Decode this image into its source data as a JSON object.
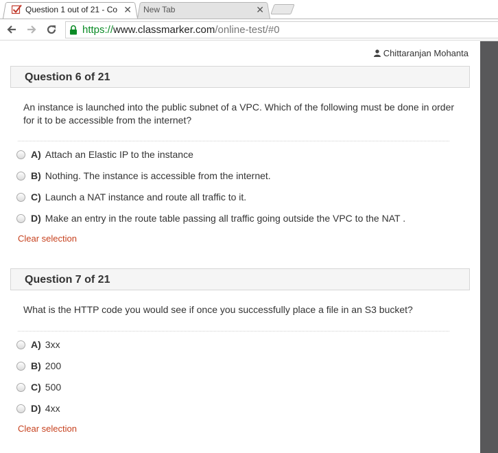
{
  "browser": {
    "tabs": [
      {
        "title": "Question 1 out of 21 - Co",
        "active": true
      },
      {
        "title": "New Tab",
        "active": false
      }
    ],
    "url": {
      "scheme": "https://",
      "host": "www.classmarker.com",
      "path": "/online-test/#0"
    },
    "accent": "#0a8a25"
  },
  "user": {
    "name": "Chittaranjan Mohanta"
  },
  "questions": [
    {
      "header": "Question 6 of 21",
      "text": "An instance is launched into the public subnet of a VPC. Which of the following must be done in order for it to be accessible from the internet?",
      "options": [
        {
          "letter": "A)",
          "text": "Attach an Elastic IP to the instance"
        },
        {
          "letter": "B)",
          "text": "Nothing. The instance is accessible from the internet."
        },
        {
          "letter": "C)",
          "text": "Launch a NAT instance and route all traffic to it."
        },
        {
          "letter": "D)",
          "text": "Make an entry in the route table passing all traffic going outside the VPC to the NAT ."
        }
      ],
      "clear_label": "Clear selection"
    },
    {
      "header": "Question 7 of 21",
      "text": "What is the HTTP code you would see if once you successfully place a file in an S3 bucket?",
      "options": [
        {
          "letter": "A)",
          "text": "3xx"
        },
        {
          "letter": "B)",
          "text": "200"
        },
        {
          "letter": "C)",
          "text": "500"
        },
        {
          "letter": "D)",
          "text": "4xx"
        }
      ],
      "clear_label": "Clear selection"
    }
  ],
  "colors": {
    "clear_link": "#c7421f",
    "scrollbar": "#58585a",
    "header_bg": "#f5f5f5"
  }
}
